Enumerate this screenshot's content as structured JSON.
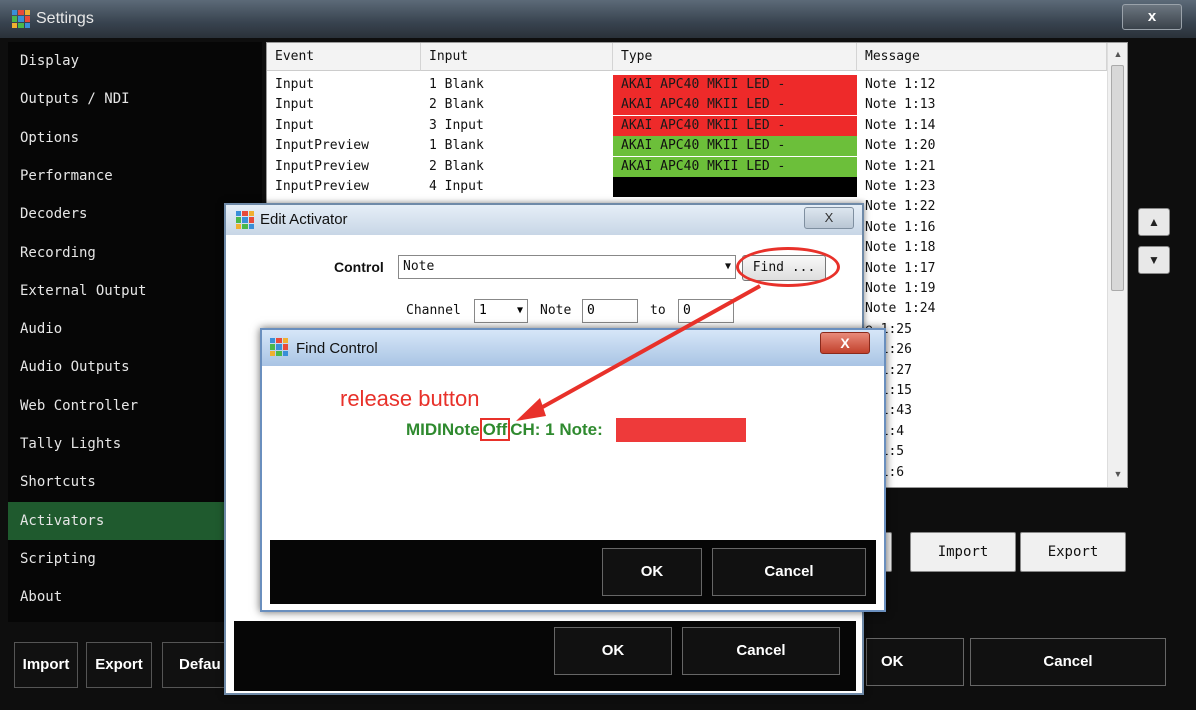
{
  "settings": {
    "title": "Settings",
    "close_label": "x",
    "sidebar": [
      {
        "label": "Display"
      },
      {
        "label": "Outputs / NDI"
      },
      {
        "label": "Options"
      },
      {
        "label": "Performance"
      },
      {
        "label": "Decoders"
      },
      {
        "label": "Recording"
      },
      {
        "label": "External Output"
      },
      {
        "label": "Audio"
      },
      {
        "label": "Audio Outputs"
      },
      {
        "label": "Web Controller"
      },
      {
        "label": "Tally Lights"
      },
      {
        "label": "Shortcuts"
      },
      {
        "label": "Activators",
        "active": true
      },
      {
        "label": "Scripting"
      },
      {
        "label": "About"
      }
    ],
    "bottom_buttons": {
      "import": "Import",
      "export": "Export",
      "default": "Defau"
    },
    "main_ok": "OK",
    "main_cancel": "Cancel",
    "import_label": "Import",
    "export_label": "Export"
  },
  "table": {
    "headers": [
      "Event",
      "Input",
      "Type",
      "Message"
    ],
    "rows": [
      {
        "event": "Input",
        "input": "1 Blank",
        "type": "AKAI APC40 MKII LED -",
        "type_color": "#ee2a2a",
        "message": "Note 1:12"
      },
      {
        "event": "Input",
        "input": "2 Blank",
        "type": "AKAI APC40 MKII LED -",
        "type_color": "#ee2a2a",
        "message": "Note 1:13"
      },
      {
        "event": "Input",
        "input": "3 Input",
        "type": "AKAI APC40 MKII LED -",
        "type_color": "#ee2a2a",
        "message": "Note 1:14"
      },
      {
        "event": "InputPreview",
        "input": "1 Blank",
        "type": "AKAI APC40 MKII LED -",
        "type_color": "#6cbf3a",
        "message": "Note 1:20"
      },
      {
        "event": "InputPreview",
        "input": "2 Blank",
        "type": "AKAI APC40 MKII LED -",
        "type_color": "#6cbf3a",
        "message": "Note 1:21"
      },
      {
        "event": "InputPreview",
        "input": "4 Input",
        "type": "",
        "type_color": "#000000",
        "message": "Note 1:23"
      }
    ],
    "messages_partial": [
      "Note 1:22",
      "Note 1:16",
      "Note 1:18",
      "Note 1:17",
      "Note 1:19",
      "Note 1:24",
      "e 1:25",
      "e 1:26",
      "e 1:27",
      "e 1:15",
      "e 1:43",
      "e 1:4",
      "e 1:5",
      "e 1:6"
    ]
  },
  "edit_activator": {
    "title": "Edit Activator",
    "close_label": "X",
    "control_label": "Control",
    "control_value": "Note",
    "find_label": "Find ...",
    "channel_label": "Channel",
    "channel_value": "1",
    "note_label": "Note",
    "note_value": "0",
    "to_label": "to",
    "to_value": "0",
    "ok": "OK",
    "cancel": "Cancel"
  },
  "find_control": {
    "title": "Find Control",
    "close_label": "X",
    "annotation": "release button",
    "midi_prefix": "MIDINote",
    "midi_off": "Off",
    "midi_rest": "CH: 1 Note:",
    "ok": "OK",
    "cancel": "Cancel"
  },
  "colors": {
    "accent_green": "#1f5a2e",
    "red": "#ee2a2a",
    "green": "#6cbf3a",
    "annotation_red": "#e8312a",
    "midi_green": "#2f8a2f"
  }
}
